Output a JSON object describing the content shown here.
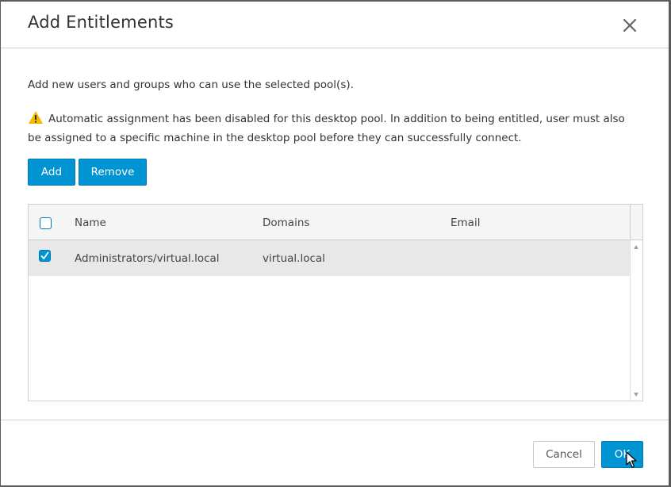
{
  "dialog": {
    "title": "Add Entitlements",
    "description": "Add new users and groups who can use the selected pool(s).",
    "warning": "Automatic assignment has been disabled for this desktop pool. In addition to being entitled, user must also be assigned to a specific machine in the desktop pool before they can successfully connect."
  },
  "toolbar": {
    "add_label": "Add",
    "remove_label": "Remove"
  },
  "grid": {
    "columns": [
      "Name",
      "Domains",
      "Email"
    ],
    "header_checked": false,
    "rows": [
      {
        "checked": true,
        "name": "Administrators/virtual.local",
        "domains": "virtual.local",
        "email": ""
      }
    ]
  },
  "footer": {
    "cancel_label": "Cancel",
    "ok_label": "OK"
  },
  "colors": {
    "primary": "#0094d2",
    "warning": "#f5b800",
    "selected_row": "#e8e8e8"
  },
  "icons": [
    "close-icon",
    "warning-icon",
    "checkmark-icon",
    "scroll-up-icon",
    "scroll-down-icon",
    "mouse-cursor-icon"
  ]
}
